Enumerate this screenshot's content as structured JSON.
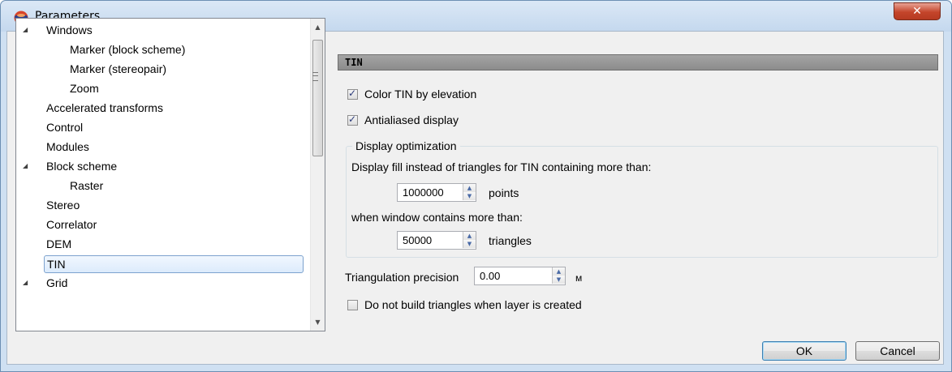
{
  "window": {
    "title": "Parameters"
  },
  "tree": {
    "items": [
      {
        "label": "Windows",
        "expanded": true
      },
      {
        "label": "Marker (block scheme)"
      },
      {
        "label": "Marker (stereopair)"
      },
      {
        "label": "Zoom"
      },
      {
        "label": "Accelerated transforms"
      },
      {
        "label": "Control"
      },
      {
        "label": "Modules"
      },
      {
        "label": "Block scheme",
        "expanded": true
      },
      {
        "label": "Raster"
      },
      {
        "label": "Stereo"
      },
      {
        "label": "Correlator"
      },
      {
        "label": "DEM"
      },
      {
        "label": "TIN",
        "selected": true
      },
      {
        "label": "Grid",
        "expanded": true
      }
    ]
  },
  "panel": {
    "header": "TIN",
    "color_by_elevation": {
      "label": "Color TIN by elevation",
      "checked": true
    },
    "antialiased": {
      "label": "Antialiased display",
      "checked": true
    },
    "optimization": {
      "title": "Display optimization",
      "fill_text": "Display fill instead of triangles for TIN containing more than:",
      "points_value": "1000000",
      "points_unit": "points",
      "window_text": "when window contains more than:",
      "triangles_value": "50000",
      "triangles_unit": "triangles"
    },
    "precision": {
      "label": "Triangulation precision",
      "value": "0.00",
      "unit": "м"
    },
    "no_build": {
      "label": "Do not build triangles when layer is created",
      "checked": false
    }
  },
  "buttons": {
    "ok": "OK",
    "cancel": "Cancel"
  },
  "icons": {
    "close": "close-icon",
    "app": "app-logo-icon",
    "scroll_up": "scroll-up-icon",
    "scroll_down": "scroll-down-icon"
  }
}
